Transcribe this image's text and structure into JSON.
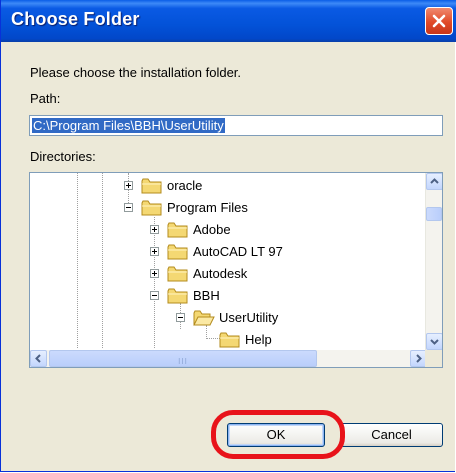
{
  "window": {
    "title": "Choose Folder"
  },
  "prompt": "Please choose the installation folder.",
  "path": {
    "label": "Path:",
    "value": "C:\\Program Files\\BBH\\UserUtility"
  },
  "directories": {
    "label": "Directories:",
    "items": [
      {
        "label": "oracle",
        "expander": "plus"
      },
      {
        "label": "Program Files",
        "expander": "minus"
      },
      {
        "label": "Adobe",
        "expander": "plus"
      },
      {
        "label": "AutoCAD LT 97",
        "expander": "plus"
      },
      {
        "label": "Autodesk",
        "expander": "plus"
      },
      {
        "label": "BBH",
        "expander": "minus"
      },
      {
        "label": "UserUtility",
        "expander": "minus"
      },
      {
        "label": "Help",
        "expander": "none"
      }
    ],
    "h_scroll_grip": "III"
  },
  "buttons": {
    "ok": "OK",
    "cancel": "Cancel"
  },
  "colors": {
    "selection": "#316ac5",
    "title_bar": "#0352d8",
    "callout_ring": "#e8131a"
  },
  "icons": [
    "close-icon",
    "folder-icon",
    "chevron-up-icon",
    "chevron-down-icon",
    "chevron-left-icon",
    "chevron-right-icon"
  ]
}
